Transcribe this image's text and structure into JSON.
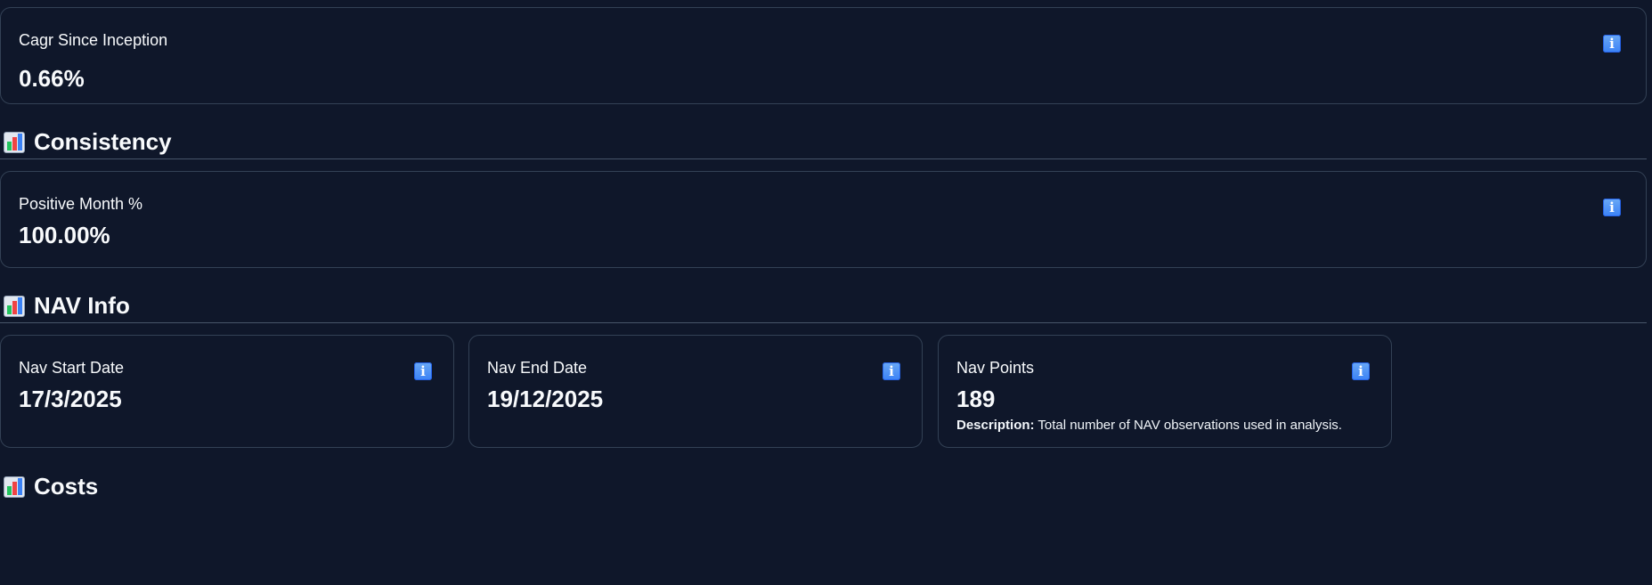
{
  "cards": {
    "cagr": {
      "label": "Cagr Since Inception",
      "value": "0.66%"
    },
    "positive_month": {
      "label": "Positive Month %",
      "value": "100.00%"
    },
    "nav_start": {
      "label": "Nav Start Date",
      "value": "17/3/2025"
    },
    "nav_end": {
      "label": "Nav End Date",
      "value": "19/12/2025"
    },
    "nav_points": {
      "label": "Nav Points",
      "value": "189",
      "description_label": "Description:",
      "description_text": " Total number of NAV observations used in analysis."
    }
  },
  "sections": {
    "consistency": {
      "title": "Consistency",
      "icon": "bar-chart-icon"
    },
    "nav_info": {
      "title": "NAV Info",
      "icon": "bar-chart-icon"
    },
    "costs": {
      "title": "Costs",
      "icon": "bar-chart-icon"
    }
  },
  "icons": {
    "info": "i"
  },
  "colors": {
    "background": "#0f172a",
    "card_border": "#334155",
    "info_icon": "#3b82f6"
  }
}
